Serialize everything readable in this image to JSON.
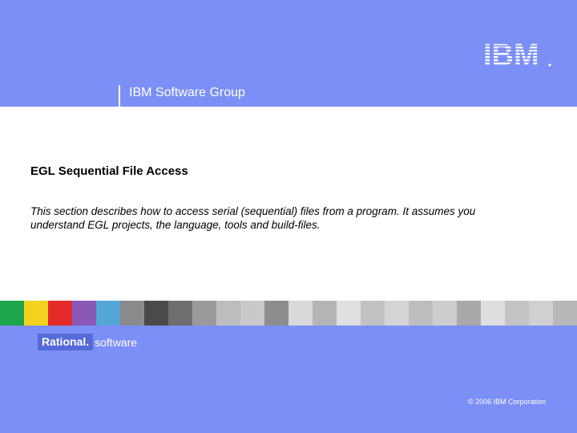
{
  "header": {
    "group_title": "IBM Software Group",
    "logo_text": "IBM"
  },
  "slide": {
    "title": "EGL Sequential File Access",
    "body": "This section describes how to access serial (sequential) files from a program.  It assumes you understand EGL projects, the language, tools and build-files."
  },
  "footer": {
    "brand_word": "Rational.",
    "brand_suffix": "software",
    "copyright": "© 2006 IBM Corporation"
  },
  "colors": {
    "background": "#7b8ff6",
    "panel": "#ffffff",
    "strip": [
      "#1fa64a",
      "#f3d31e",
      "#e52a2a",
      "#8a58b6",
      "#53a7d6",
      "#8a8a8a",
      "#4a4a4a",
      "#6e6e6e",
      "#9a9a9a",
      "#bdbdbd",
      "#c9c9c9",
      "#8d8d8d",
      "#d9d9d9",
      "#b5b5b5",
      "#e0e0e0",
      "#c2c2c2",
      "#d4d4d4",
      "#bdbdbd",
      "#cdcdcd",
      "#a9a9a9",
      "#dedede",
      "#c3c3c3",
      "#d0d0d0",
      "#b8b8b8"
    ]
  }
}
